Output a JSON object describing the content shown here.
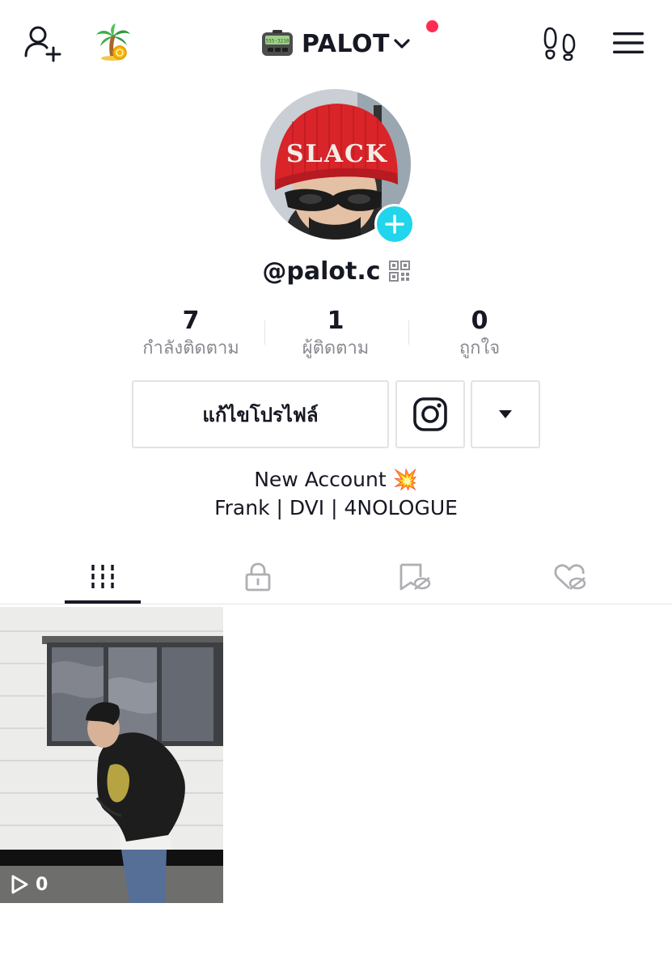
{
  "header": {
    "title": "PALOT",
    "add_friend_icon": "person-plus-icon",
    "coin_icon": "palm-coin-icon",
    "pager_icon": "pager-icon",
    "footprints_icon": "footprints-icon",
    "menu_icon": "hamburger-menu-icon",
    "pager_display_text": "555-3210",
    "notification_dot_color": "#fe2c55"
  },
  "profile": {
    "username": "@palot.c",
    "avatar_hat_text": "SLACK",
    "avatar_plus_color": "#20d5ec"
  },
  "stats": [
    {
      "value": "7",
      "label": "กำลังติดตาม"
    },
    {
      "value": "1",
      "label": "ผู้ติดตาม"
    },
    {
      "value": "0",
      "label": "ถูกใจ"
    }
  ],
  "actions": {
    "edit_profile_label": "แก้ไขโปรไฟล์",
    "instagram_icon": "instagram-icon",
    "more_icon": "caret-down-icon"
  },
  "bio": {
    "line1": "New Account",
    "line1_emoji": "💥",
    "line2": "Frank | DVI | 4NOLOGUE"
  },
  "tabs": [
    {
      "name": "videos",
      "icon": "grid-bars-icon",
      "active": true
    },
    {
      "name": "private",
      "icon": "lock-icon",
      "active": false
    },
    {
      "name": "bookmarked",
      "icon": "bookmark-hidden-icon",
      "active": false
    },
    {
      "name": "liked",
      "icon": "heart-hidden-icon",
      "active": false
    }
  ],
  "videos": [
    {
      "views": "0"
    }
  ]
}
